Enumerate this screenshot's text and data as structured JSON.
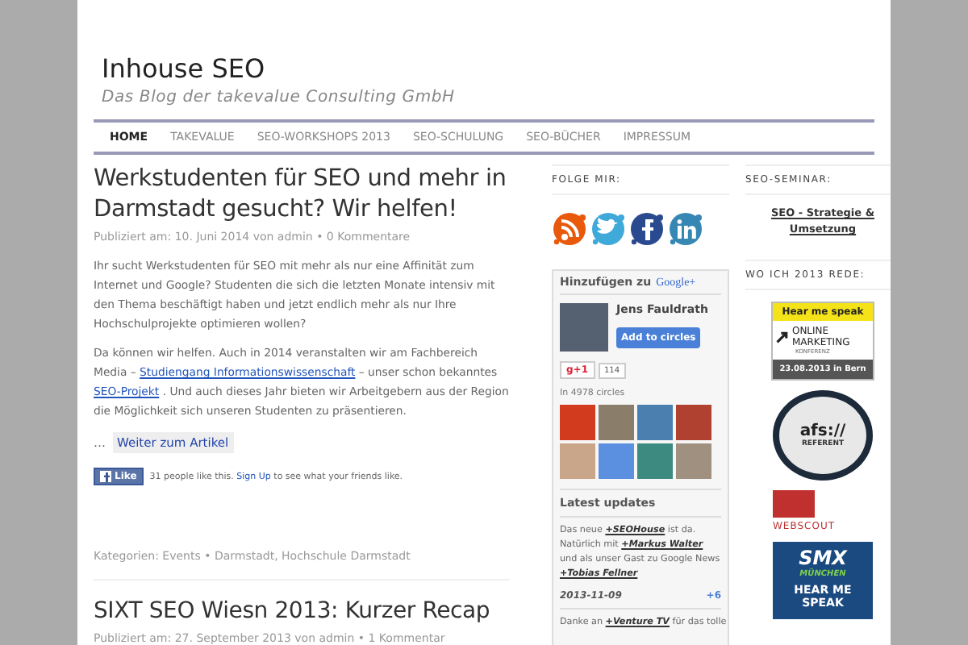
{
  "site": {
    "title": "Inhouse SEO",
    "tagline": "Das Blog der takevalue Consulting GmbH"
  },
  "nav": [
    {
      "label": "HOME",
      "selected": true
    },
    {
      "label": "TAKEVALUE",
      "selected": false
    },
    {
      "label": "SEO-WORKSHOPS 2013",
      "selected": false
    },
    {
      "label": "SEO-SCHULUNG",
      "selected": false
    },
    {
      "label": "SEO-BÜCHER",
      "selected": false
    },
    {
      "label": "IMPRESSUM",
      "selected": false
    }
  ],
  "posts": [
    {
      "title": "Werkstudenten für SEO und mehr in Darmstadt gesucht? Wir helfen!",
      "meta": "Publiziert am: 10. Juni 2014 von admin • 0 Kommentare",
      "paragraphs": [
        [
          {
            "text": "Ihr sucht Werkstudenten für SEO mit mehr als nur eine Affinität zum Internet und Google? Studenten die sich die letzten Monate intensiv mit den Thema beschäftigt haben und jetzt endlich mehr als nur Ihre Hochschulprojekte optimieren wollen?",
            "link": false
          }
        ],
        [
          {
            "text": "Da können wir helfen. Auch in 2014 veranstalten wir am Fachbereich Media –",
            "link": false
          },
          {
            "text": "Studiengang Informationswissenschaft",
            "link": true
          },
          {
            "text": "– unser schon bekanntes",
            "link": false
          },
          {
            "text": "SEO-Projekt",
            "link": true
          },
          {
            "text": ". Und auch dieses Jahr bieten wir Arbeitgebern aus der Region die Möglichkeit sich unseren Studenten zu präsentieren.",
            "link": false
          }
        ]
      ],
      "read_more": {
        "prefix": "…",
        "label": "Weiter zum Artikel"
      },
      "like": {
        "button": "Like",
        "parts": [
          {
            "text": "31 people like this.",
            "link": false
          },
          {
            "text": "Sign Up",
            "link": true
          },
          {
            "text": "to see what your friends like.",
            "link": false
          }
        ]
      },
      "categories": "Kategorien: Events • Darmstadt, Hochschule Darmstadt"
    },
    {
      "title": "SIXT SEO Wiesn 2013: Kurzer Recap",
      "meta": "Publiziert am: 27. September 2013 von admin • 1 Kommentar"
    }
  ],
  "follow": {
    "heading": "FOLGE MIR:",
    "icons": [
      {
        "kind": "rss"
      },
      {
        "kind": "twitter"
      },
      {
        "kind": "facebook"
      },
      {
        "kind": "linkedin"
      }
    ]
  },
  "gplus": {
    "heading": "Hinzufügen zu",
    "brand": "Google+",
    "name": "Jens Fauldrath",
    "add_button": "Add to circles",
    "plus_one": "g+1",
    "plus_count": "114",
    "circles": "In 4978 circles",
    "avatars": [
      {
        "color": "#d23b1e"
      },
      {
        "color": "#8a7d6a"
      },
      {
        "color": "#4a7fb0"
      },
      {
        "color": "#b04030"
      },
      {
        "color": "#c9a58a"
      },
      {
        "color": "#5b8fe0"
      },
      {
        "color": "#3d8a80"
      },
      {
        "color": "#a09080"
      }
    ],
    "updates_heading": "Latest updates",
    "update": [
      {
        "text": "Das neue",
        "mention": false
      },
      {
        "text": "+SEOHouse",
        "mention": true
      },
      {
        "text": "ist da. Natürlich mit",
        "mention": false
      },
      {
        "text": "+Markus Walter",
        "mention": true
      },
      {
        "text": "und als unser Gast zu Google News",
        "mention": false
      },
      {
        "text": "+Tobias Fellner",
        "mention": true
      }
    ],
    "date": "2013-11-09",
    "plus_more": "+6",
    "next_update": [
      {
        "text": "Danke an",
        "mention": false
      },
      {
        "text": "+Venture TV",
        "mention": true
      },
      {
        "text": "für das tolle",
        "mention": false
      }
    ]
  },
  "seminar": {
    "heading": "SEO-SEMINAR:",
    "link": "SEO - Strategie & Umsetzung"
  },
  "talks": {
    "heading": "WO ICH 2013 REDE:",
    "banners": [
      {
        "kind": "omk",
        "lines": [
          "Hear me speak",
          "ONLINE MARKETING",
          "KONFERENZ",
          "23.08.2013 in Bern"
        ]
      },
      {
        "kind": "afs",
        "lines": [
          "afs://",
          "REFERENT"
        ]
      },
      {
        "kind": "webscout",
        "lines": [
          "WEBSCOUT"
        ]
      },
      {
        "kind": "smx",
        "lines": [
          "SMX",
          "MÜNCHEN",
          "HEAR ME SPEAK"
        ]
      }
    ]
  }
}
